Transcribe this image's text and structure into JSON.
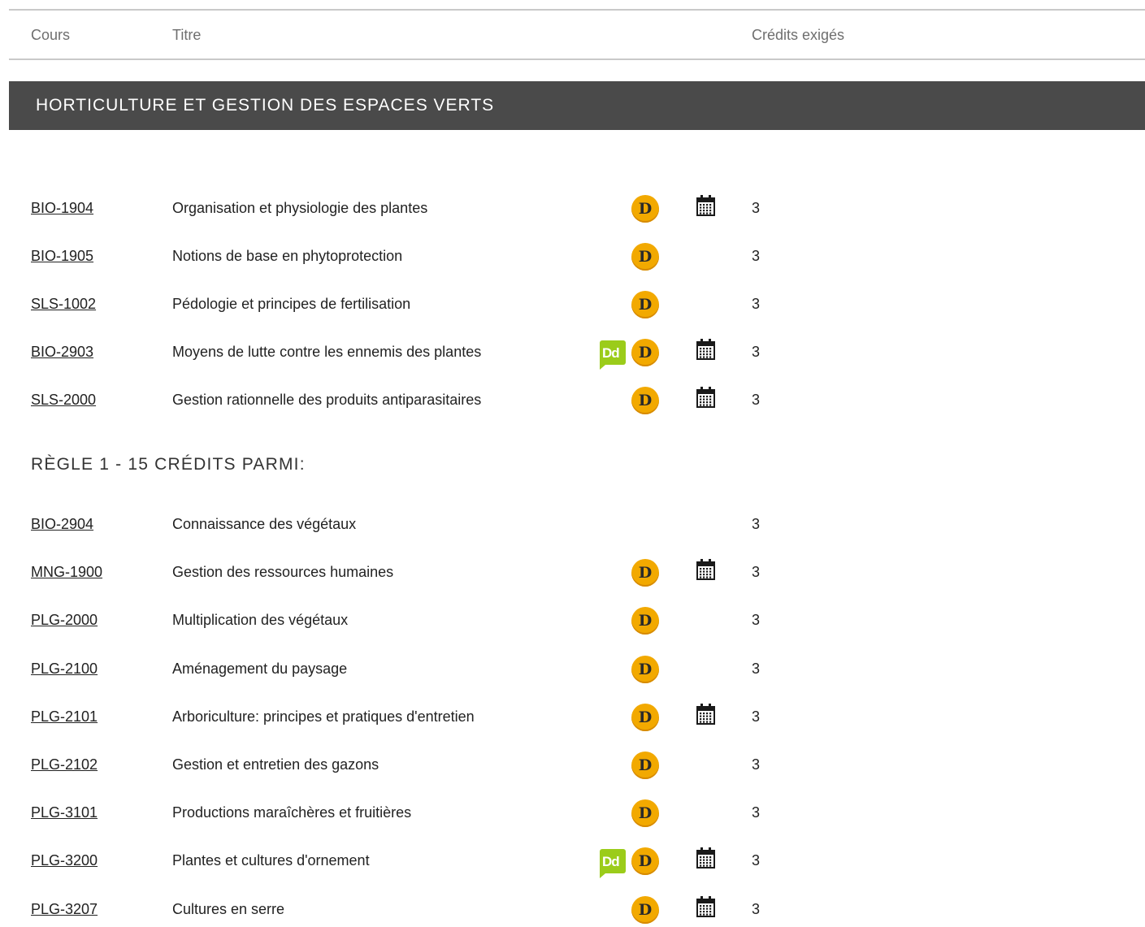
{
  "table_header": {
    "course": "Cours",
    "title": "Titre",
    "credits": "Crédits exigés"
  },
  "section": {
    "title": "HORTICULTURE ET GESTION DES ESPACES VERTS",
    "courses": [
      {
        "code": "BIO-1904",
        "title": "Organisation et physiologie des plantes",
        "dd": false,
        "d": true,
        "calendar": true,
        "credits": "3"
      },
      {
        "code": "BIO-1905",
        "title": "Notions de base en phytoprotection",
        "dd": false,
        "d": true,
        "calendar": false,
        "credits": "3"
      },
      {
        "code": "SLS-1002",
        "title": "Pédologie et principes de fertilisation",
        "dd": false,
        "d": true,
        "calendar": false,
        "credits": "3"
      },
      {
        "code": "BIO-2903",
        "title": "Moyens de lutte contre les ennemis des plantes",
        "dd": true,
        "d": true,
        "calendar": true,
        "credits": "3"
      },
      {
        "code": "SLS-2000",
        "title": "Gestion rationnelle des produits antiparasitaires",
        "dd": false,
        "d": true,
        "calendar": true,
        "credits": "3"
      }
    ],
    "rule": {
      "title": "RÈGLE 1 - 15 CRÉDITS PARMI:",
      "courses": [
        {
          "code": "BIO-2904",
          "title": "Connaissance des végétaux",
          "dd": false,
          "d": false,
          "calendar": false,
          "credits": "3"
        },
        {
          "code": "MNG-1900",
          "title": "Gestion des ressources humaines",
          "dd": false,
          "d": true,
          "calendar": true,
          "credits": "3"
        },
        {
          "code": "PLG-2000",
          "title": "Multiplication des végétaux",
          "dd": false,
          "d": true,
          "calendar": false,
          "credits": "3"
        },
        {
          "code": "PLG-2100",
          "title": "Aménagement du paysage",
          "dd": false,
          "d": true,
          "calendar": false,
          "credits": "3"
        },
        {
          "code": "PLG-2101",
          "title": "Arboriculture: principes et pratiques d'entretien",
          "dd": false,
          "d": true,
          "calendar": true,
          "credits": "3"
        },
        {
          "code": "PLG-2102",
          "title": "Gestion et entretien des gazons",
          "dd": false,
          "d": true,
          "calendar": false,
          "credits": "3"
        },
        {
          "code": "PLG-3101",
          "title": "Productions maraîchères et fruitières",
          "dd": false,
          "d": true,
          "calendar": false,
          "credits": "3"
        },
        {
          "code": "PLG-3200",
          "title": "Plantes et cultures d'ornement",
          "dd": true,
          "d": true,
          "calendar": true,
          "credits": "3"
        },
        {
          "code": "PLG-3207",
          "title": "Cultures en serre",
          "dd": false,
          "d": true,
          "calendar": true,
          "credits": "3"
        }
      ]
    }
  },
  "badges": {
    "dd_icon_text": "Dd",
    "d_icon_text": "D",
    "dd_color": "#9bcc1a",
    "d_color": "#f2a900",
    "dd_icon_name": "dd-speech-icon",
    "d_icon_name": "d-coin-icon",
    "calendar_icon_name": "calendar-icon"
  }
}
